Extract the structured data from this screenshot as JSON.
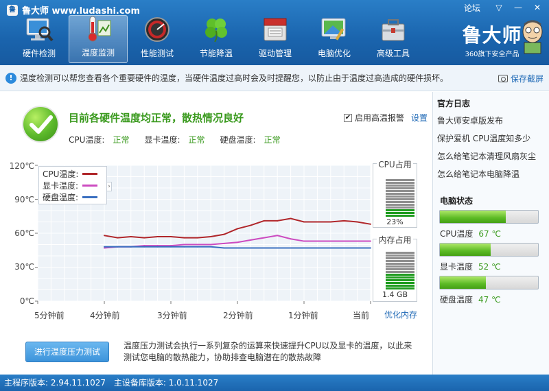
{
  "app": {
    "title": "鲁大师 www.ludashi.com",
    "logo_char": "鲁"
  },
  "window": {
    "forum": "论坛",
    "dropdown": "▽",
    "minimize": "—",
    "close": "✕"
  },
  "toolbar": [
    {
      "label": "硬件检测",
      "icon": "monitor-magnifier-icon"
    },
    {
      "label": "温度监测",
      "icon": "thermometer-icon",
      "active": true
    },
    {
      "label": "性能测试",
      "icon": "speedometer-icon"
    },
    {
      "label": "节能降温",
      "icon": "clover-icon"
    },
    {
      "label": "驱动管理",
      "icon": "driver-box-icon"
    },
    {
      "label": "电脑优化",
      "icon": "monitor-clean-icon"
    },
    {
      "label": "高级工具",
      "icon": "toolbox-icon"
    }
  ],
  "brand": {
    "name": "鲁大师",
    "tagline": "360旗下安全产品"
  },
  "infobar": {
    "text": "温度检测可以帮您查看各个重要硬件的温度，当硬件温度过高时会及时提醒您，以防止由于温度过高造成的硬件损坏。",
    "save_label": "保存截屏"
  },
  "status": {
    "headline": "目前各硬件温度均正常，散热情况良好",
    "items": [
      {
        "label": "CPU温度:",
        "value": "正常"
      },
      {
        "label": "显卡温度:",
        "value": "正常"
      },
      {
        "label": "硬盘温度:",
        "value": "正常"
      }
    ],
    "alarm_label": "启用高温报警",
    "alarm_checked": "✔",
    "settings_label": "设置"
  },
  "chart_data": {
    "type": "line",
    "y_ticks": [
      "120℃",
      "90℃",
      "60℃",
      "30℃",
      "0℃"
    ],
    "x_ticks": [
      "5分钟前",
      "4分钟前",
      "3分钟前",
      "2分钟前",
      "1分钟前",
      "当前"
    ],
    "ylim": [
      0,
      120
    ],
    "x": [
      -4,
      -3.8,
      -3.6,
      -3.4,
      -3.2,
      -3.0,
      -2.8,
      -2.6,
      -2.4,
      -2.2,
      -2.0,
      -1.8,
      -1.6,
      -1.4,
      -1.2,
      -1.0,
      -0.8,
      -0.6,
      -0.4,
      -0.2,
      0
    ],
    "series": [
      {
        "name": "CPU温度:",
        "color": "#b0262a",
        "values": [
          58,
          56,
          57,
          56,
          57,
          57,
          56,
          56,
          57,
          59,
          64,
          67,
          71,
          71,
          73,
          70,
          70,
          70,
          71,
          70,
          68
        ]
      },
      {
        "name": "显卡温度:",
        "color": "#cc4bc0",
        "values": [
          47,
          48,
          48,
          49,
          49,
          49,
          50,
          50,
          50,
          51,
          52,
          54,
          56,
          58,
          55,
          53,
          53,
          53,
          53,
          53,
          53
        ]
      },
      {
        "name": "硬盘温度:",
        "color": "#3a6fc0",
        "values": [
          48,
          48,
          48,
          48,
          48,
          48,
          48,
          48,
          48,
          47,
          47,
          47,
          47,
          47,
          47,
          47,
          47,
          47,
          47,
          47,
          47
        ]
      }
    ],
    "grid": true,
    "legend": "top-left"
  },
  "meters": {
    "cpu": {
      "title": "CPU占用",
      "percent": 23,
      "value": "23%"
    },
    "mem": {
      "title": "内存占用",
      "fraction": 0.45,
      "value": "1.4 GB"
    }
  },
  "optimize_label": "优化内存",
  "stress": {
    "button": "进行温度压力测试",
    "desc": "温度压力测试会执行一系列复杂的运算来快速提升CPU以及显卡的温度，以此来测试您电脑的散热能力，协助排查电脑潜在的散热故障"
  },
  "sidebar": {
    "blog_title": "官方日志",
    "blog_items": [
      "鲁大师安卓版发布",
      "保护爱机 CPU温度知多少",
      "怎么给笔记本清理风扇灰尘",
      "怎么给笔记本电脑降温"
    ],
    "pc_title": "电脑状态",
    "temps": [
      {
        "label": "CPU温度",
        "value": "67 ℃",
        "level": 0.67
      },
      {
        "label": "显卡温度",
        "value": "52 ℃",
        "level": 0.52
      },
      {
        "label": "硬盘温度",
        "value": "47 ℃",
        "level": 0.47
      }
    ]
  },
  "footer": {
    "main_version": "主程序版本: 2.94.11.1027",
    "db_version": "主设备库版本: 1.0.11.1027"
  }
}
